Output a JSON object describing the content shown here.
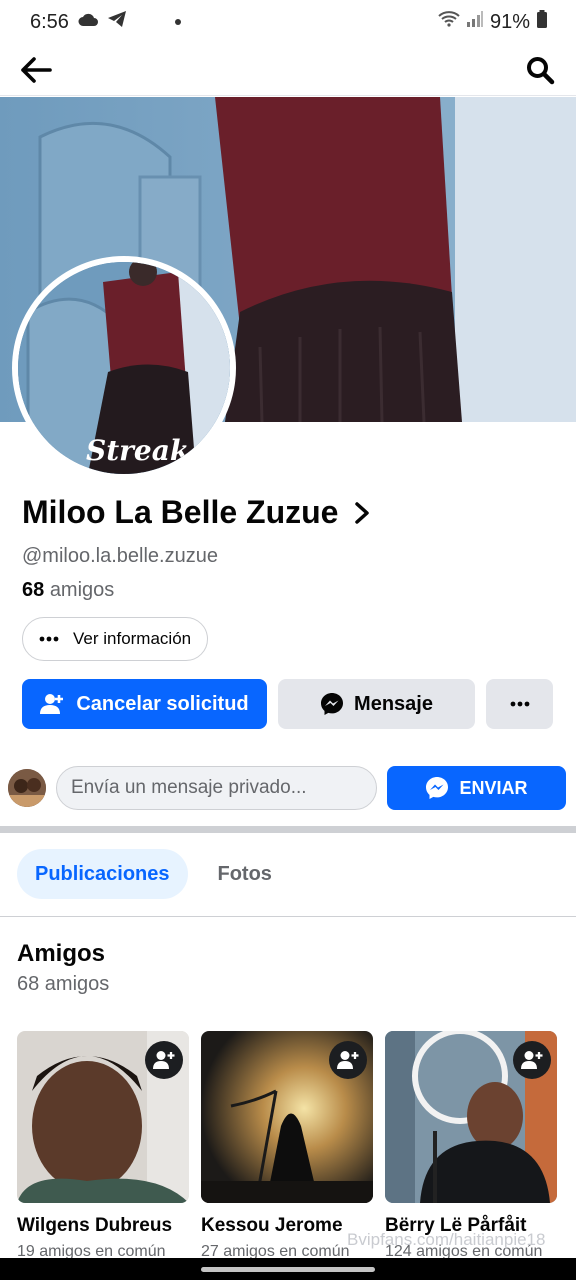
{
  "status": {
    "time": "6:56",
    "battery": "91%"
  },
  "profile": {
    "name": "Miloo La Belle Zuzue",
    "handle": "@miloo.la.belle.zuzue",
    "friends_number": "68",
    "friends_word": "amigos",
    "avatar_overlay_text": "Streak"
  },
  "buttons": {
    "info": "Ver información",
    "cancel_request": "Cancelar solicitud",
    "message": "Mensaje",
    "send": "ENVIAR"
  },
  "message_input": {
    "placeholder": "Envía un mensaje privado..."
  },
  "tabs": [
    {
      "label": "Publicaciones",
      "active": true
    },
    {
      "label": "Fotos",
      "active": false
    }
  ],
  "friends_section": {
    "title": "Amigos",
    "subtitle": "68 amigos",
    "friends": [
      {
        "name": "Wilgens Dubreus",
        "mutual": "19 amigos en común"
      },
      {
        "name": "Kessou Jerome",
        "mutual": "27 amigos en común"
      },
      {
        "name": "Bërry Lë Pårfåit",
        "mutual": "124 amigos en común"
      }
    ]
  },
  "watermark": "Bvipfans.com/haitianpie18",
  "colors": {
    "accent": "#0866ff",
    "secondary_bg": "#e4e6eb",
    "text_muted": "#65676b"
  }
}
